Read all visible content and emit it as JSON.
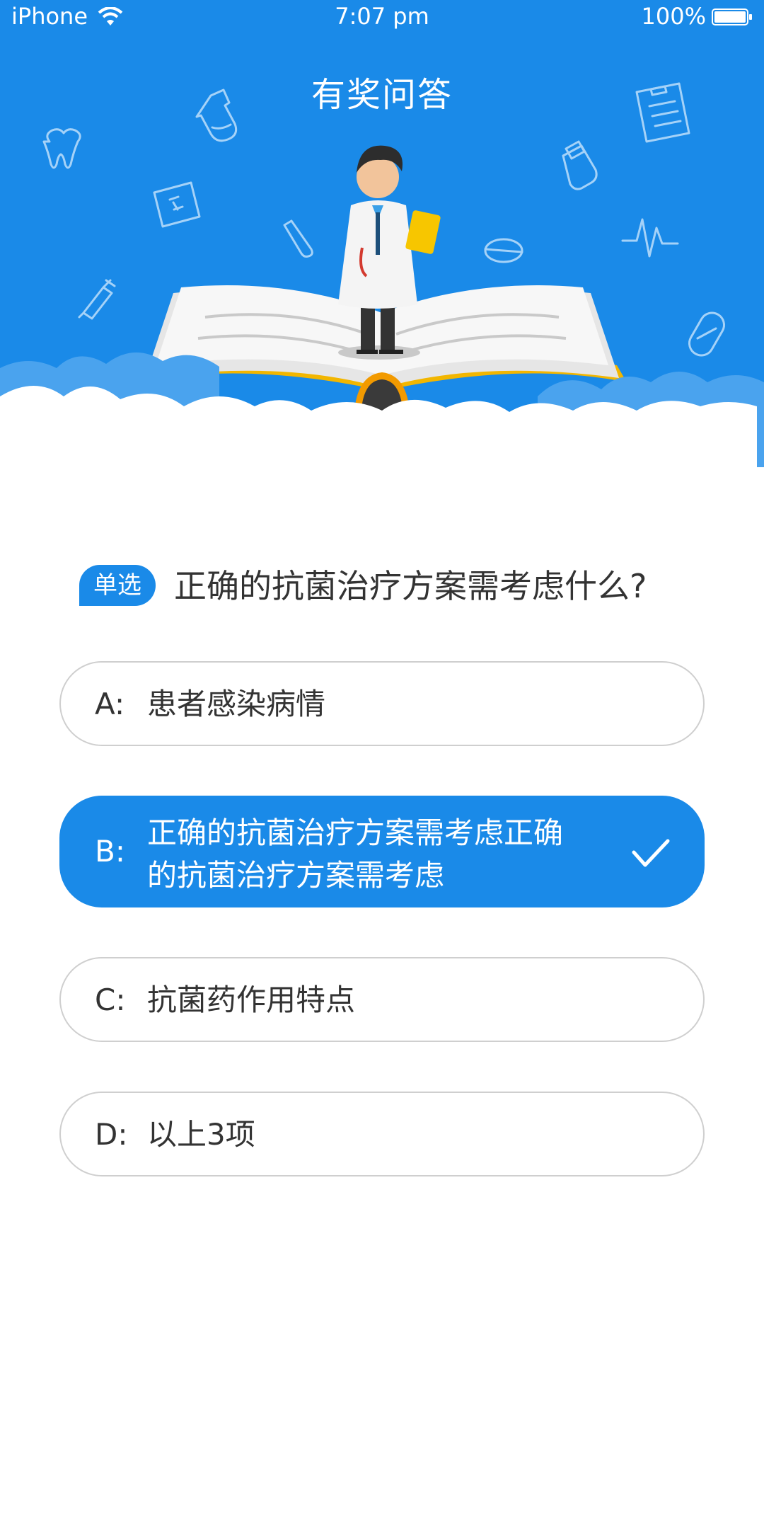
{
  "status_bar": {
    "carrier": "iPhone",
    "time": "7:07 pm",
    "battery": "100%"
  },
  "header": {
    "title": "有奖问答",
    "background_color": "#1a8ae8",
    "illustration": "doctor-on-open-book"
  },
  "question": {
    "type_badge": "单选",
    "text": "正确的抗菌治疗方案需考虑什么?"
  },
  "options": [
    {
      "letter": "A:",
      "text": "患者感染病情",
      "selected": false
    },
    {
      "letter": "B:",
      "text_line1": "正确的抗菌治疗方案需考虑正确",
      "text_line2": "的抗菌治疗方案需考虑",
      "selected": true,
      "check_icon": "checkmark-icon"
    },
    {
      "letter": "C:",
      "text": "抗菌药作用特点",
      "selected": false
    },
    {
      "letter": "D:",
      "text": "以上3项",
      "selected": false
    }
  ],
  "colors": {
    "accent": "#1a8ae8",
    "text": "#333333",
    "border": "#cfcfcf"
  }
}
